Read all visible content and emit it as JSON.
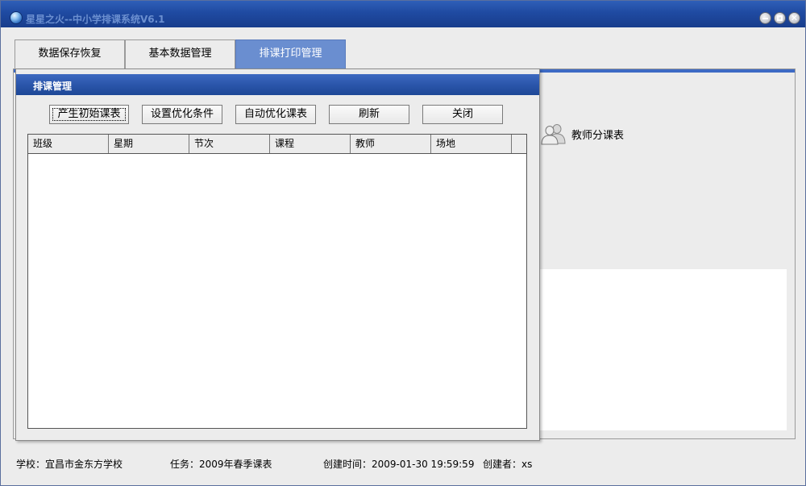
{
  "window": {
    "title": "星星之火--中小学排课系统V6.1"
  },
  "tabs": [
    {
      "label": "数据保存恢复"
    },
    {
      "label": "基本数据管理"
    },
    {
      "label": "排课打印管理",
      "selected": true
    }
  ],
  "side_panel": {
    "items": [
      {
        "label": "教师分课表",
        "icon": "people-icon"
      }
    ]
  },
  "dialog": {
    "title": "排课管理",
    "buttons": [
      {
        "label": "产生初始课表",
        "focused": true
      },
      {
        "label": "设置优化条件"
      },
      {
        "label": "自动优化课表"
      },
      {
        "label": "刷新"
      },
      {
        "label": "关闭"
      }
    ],
    "table": {
      "columns": [
        "班级",
        "星期",
        "节次",
        "课程",
        "教师",
        "场地"
      ],
      "rows": []
    }
  },
  "status_bar": {
    "school": "学校：宜昌市金东方学校",
    "task": "任务：2009年春季课表",
    "created_time": "创建时间：2009-01-30 19:59:59",
    "creator": "创建者：xs"
  },
  "colors": {
    "title_bar": "#1f4aa1",
    "selected_tab": "#6a8ed0",
    "window_bg": "#ececec",
    "accent": "#3d6ac4"
  }
}
